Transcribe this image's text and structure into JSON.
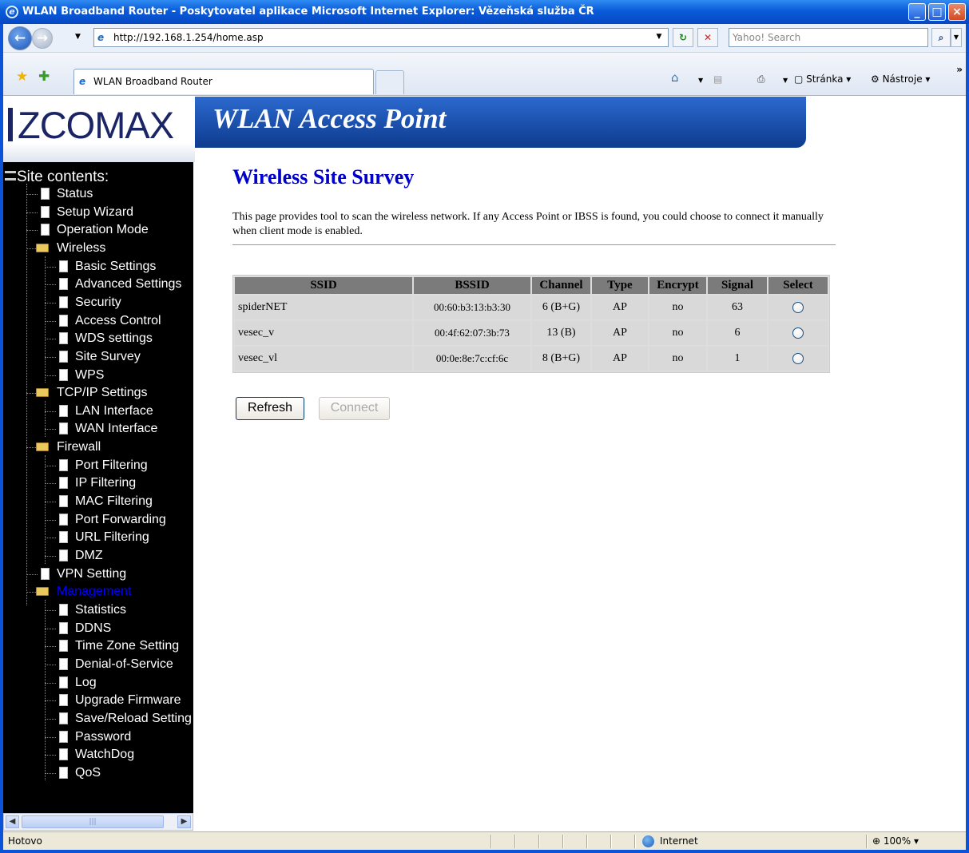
{
  "window": {
    "title": "WLAN Broadband Router - Poskytovatel aplikace Microsoft Internet Explorer: Vězeňská služba ČR"
  },
  "browser": {
    "url": "http://192.168.1.254/home.asp",
    "search_placeholder": "Yahoo! Search",
    "tab_title": "WLAN Broadband Router",
    "cmd_page": "Stránka",
    "cmd_tools": "Nástroje"
  },
  "banner": {
    "logo": "ZCOMAX",
    "product": "WLAN Access Point"
  },
  "sidebar": {
    "heading": "Site contents:",
    "items": [
      {
        "label": "Status",
        "level": 0,
        "kind": "doc"
      },
      {
        "label": "Setup Wizard",
        "level": 0,
        "kind": "doc"
      },
      {
        "label": "Operation Mode",
        "level": 0,
        "kind": "doc"
      },
      {
        "label": "Wireless",
        "level": 0,
        "kind": "folder"
      },
      {
        "label": "Basic Settings",
        "level": 1,
        "kind": "doc"
      },
      {
        "label": "Advanced Settings",
        "level": 1,
        "kind": "doc"
      },
      {
        "label": "Security",
        "level": 1,
        "kind": "doc"
      },
      {
        "label": "Access Control",
        "level": 1,
        "kind": "doc"
      },
      {
        "label": "WDS settings",
        "level": 1,
        "kind": "doc"
      },
      {
        "label": "Site Survey",
        "level": 1,
        "kind": "doc"
      },
      {
        "label": "WPS",
        "level": 1,
        "kind": "doc"
      },
      {
        "label": "TCP/IP Settings",
        "level": 0,
        "kind": "folder"
      },
      {
        "label": "LAN Interface",
        "level": 1,
        "kind": "doc"
      },
      {
        "label": "WAN Interface",
        "level": 1,
        "kind": "doc"
      },
      {
        "label": "Firewall",
        "level": 0,
        "kind": "folder"
      },
      {
        "label": "Port Filtering",
        "level": 1,
        "kind": "doc"
      },
      {
        "label": "IP Filtering",
        "level": 1,
        "kind": "doc"
      },
      {
        "label": "MAC Filtering",
        "level": 1,
        "kind": "doc"
      },
      {
        "label": "Port Forwarding",
        "level": 1,
        "kind": "doc"
      },
      {
        "label": "URL Filtering",
        "level": 1,
        "kind": "doc"
      },
      {
        "label": "DMZ",
        "level": 1,
        "kind": "doc"
      },
      {
        "label": "VPN Setting",
        "level": 0,
        "kind": "doc"
      },
      {
        "label": "Management",
        "level": 0,
        "kind": "folder",
        "active": true
      },
      {
        "label": "Statistics",
        "level": 1,
        "kind": "doc"
      },
      {
        "label": "DDNS",
        "level": 1,
        "kind": "doc"
      },
      {
        "label": "Time Zone Setting",
        "level": 1,
        "kind": "doc"
      },
      {
        "label": "Denial-of-Service",
        "level": 1,
        "kind": "doc"
      },
      {
        "label": "Log",
        "level": 1,
        "kind": "doc"
      },
      {
        "label": "Upgrade Firmware",
        "level": 1,
        "kind": "doc"
      },
      {
        "label": "Save/Reload Setting",
        "level": 1,
        "kind": "doc"
      },
      {
        "label": "Password",
        "level": 1,
        "kind": "doc"
      },
      {
        "label": "WatchDog",
        "level": 1,
        "kind": "doc"
      },
      {
        "label": "QoS",
        "level": 1,
        "kind": "doc"
      }
    ]
  },
  "main": {
    "title": "Wireless Site Survey",
    "description": "This page provides tool to scan the wireless network. If any Access Point or IBSS is found, you could choose to connect it manually when client mode is enabled.",
    "table": {
      "headers": [
        "SSID",
        "BSSID",
        "Channel",
        "Type",
        "Encrypt",
        "Signal",
        "Select"
      ],
      "rows": [
        [
          "spiderNET",
          "00:60:b3:13:b3:30",
          "6 (B+G)",
          "AP",
          "no",
          "63"
        ],
        [
          "vesec_v",
          "00:4f:62:07:3b:73",
          "13 (B)",
          "AP",
          "no",
          "6"
        ],
        [
          "vesec_vl",
          "00:0e:8e:7c:cf:6c",
          "8 (B+G)",
          "AP",
          "no",
          "1"
        ]
      ]
    },
    "refresh_label": "Refresh",
    "connect_label": "Connect"
  },
  "statusbar": {
    "left": "Hotovo",
    "zone": "Internet",
    "zoom": "100%"
  },
  "colors": {
    "title_blue": "#0000cc",
    "active_nav": "#0000ff",
    "banner_blue": "#1d4fa8"
  }
}
